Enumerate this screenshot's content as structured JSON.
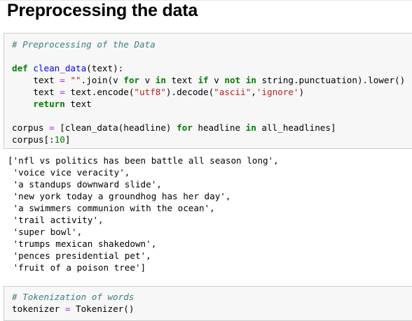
{
  "heading": "Preprocessing the data",
  "cell1": {
    "comment": "# Preprocessing of the Data",
    "def_kw": "def",
    "func_name": "clean_data",
    "def_rest": "(text):",
    "l3_a": "    text ",
    "l3_eq": "=",
    "l3_b": " ",
    "l3_str": "\"\"",
    "l3_c": ".join(v ",
    "l3_for": "for",
    "l3_d": " v ",
    "l3_in": "in",
    "l3_e": " text ",
    "l3_if": "if",
    "l3_f": " v ",
    "l3_not": "not",
    "l3_g": " ",
    "l3_in2": "in",
    "l3_h": " string.punctuation).lower()",
    "l4_a": "    text ",
    "l4_eq": "=",
    "l4_b": " text.encode(",
    "l4_s1": "\"utf8\"",
    "l4_c": ").decode(",
    "l4_s2": "\"ascii\"",
    "l4_d": ",",
    "l4_s3": "'ignore'",
    "l4_e": ")",
    "l5_a": "    ",
    "l5_ret": "return",
    "l5_b": " text",
    "l7_a": "corpus ",
    "l7_eq": "=",
    "l7_b": " [clean_data(headline) ",
    "l7_for": "for",
    "l7_c": " headline ",
    "l7_in": "in",
    "l7_d": " all_headlines]",
    "l8_a": "corpus[:",
    "l8_num": "10",
    "l8_b": "]"
  },
  "output": [
    "['nfl vs politics has been battle all season long',",
    " 'voice vice veracity',",
    " 'a standups downward slide',",
    " 'new york today a groundhog has her day',",
    " 'a swimmers communion with the ocean',",
    " 'trail activity',",
    " 'super bowl',",
    " 'trumps mexican shakedown',",
    " 'pences presidential pet',",
    " 'fruit of a poison tree']"
  ],
  "cell2": {
    "comment": "# Tokenization of words",
    "l2_a": "tokenizer ",
    "l2_eq": "=",
    "l2_b": " Tokenizer()"
  }
}
